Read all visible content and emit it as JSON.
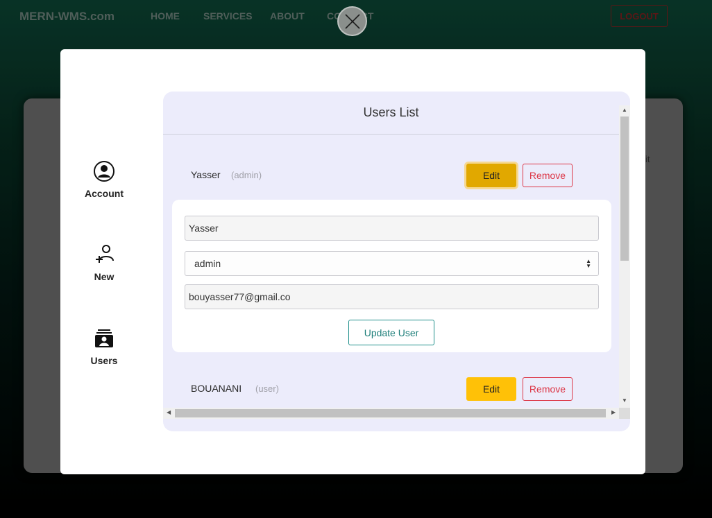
{
  "navbar": {
    "brand": "MERN-WMS.com",
    "links": [
      "HOME",
      "SERVICES",
      "ABOUT",
      "CONTACT"
    ],
    "logout_label": "LOGOUT",
    "background_hint": "it"
  },
  "sidebar": {
    "items": [
      {
        "label": "Account",
        "icon": "account-circle-icon"
      },
      {
        "label": "New",
        "icon": "add-user-icon"
      },
      {
        "label": "Users",
        "icon": "users-card-icon"
      }
    ]
  },
  "users_panel": {
    "title": "Users List",
    "users": [
      {
        "name": "Yasser",
        "role": "(admin)",
        "edit_label": "Edit",
        "remove_label": "Remove",
        "editing": true
      },
      {
        "name": "BOUANANI",
        "role": "(user)",
        "edit_label": "Edit",
        "remove_label": "Remove",
        "editing": false
      }
    ],
    "edit_form": {
      "name_value": "Yasser",
      "role_value": "admin",
      "email_value": "bouyasser77@gmail.co",
      "update_label": "Update User"
    }
  },
  "colors": {
    "edit_button": "#ffc107",
    "remove_border": "#dc3545",
    "update_border": "#1e8f8a",
    "panel_bg": "#ececfb"
  }
}
